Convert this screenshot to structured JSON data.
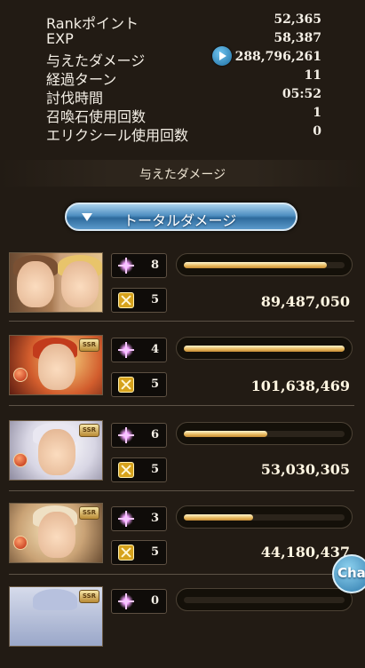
{
  "stats": [
    {
      "label": "Rankポイント",
      "value": "52,365"
    },
    {
      "label": "EXP",
      "value": "58,387"
    },
    {
      "label": "与えたダメージ",
      "value": "288,796,261"
    },
    {
      "label": "経過ターン",
      "value": "11"
    },
    {
      "label": "討伐時間",
      "value": "05:52"
    },
    {
      "label": "召喚石使用回数",
      "value": "1"
    },
    {
      "label": "エリクシール使用回数",
      "value": "0"
    }
  ],
  "section_heading": "与えたダメージ",
  "sort_button": {
    "label": "トータルダメージ",
    "icon": "chevron-down-icon"
  },
  "rows": [
    {
      "character_count": "8",
      "turn_count": "5",
      "damage": "89,487,050",
      "bar_fraction": 0.89
    },
    {
      "character_count": "4",
      "turn_count": "5",
      "damage": "101,638,469",
      "bar_fraction": 1.0,
      "rarity": "SSR"
    },
    {
      "character_count": "6",
      "turn_count": "5",
      "damage": "53,030,305",
      "bar_fraction": 0.52,
      "rarity": "SSR"
    },
    {
      "character_count": "3",
      "turn_count": "5",
      "damage": "44,180,437",
      "bar_fraction": 0.43,
      "rarity": "SSR"
    },
    {
      "character_count": "0",
      "turn_count": "",
      "damage": "",
      "bar_fraction": 0.0,
      "rarity": "SSR"
    }
  ],
  "chat_button": {
    "label": "Chat"
  },
  "colors": {
    "background": "#221b14",
    "bar_fill": "#e7b85c",
    "button_blue": "#4f8fc1"
  }
}
